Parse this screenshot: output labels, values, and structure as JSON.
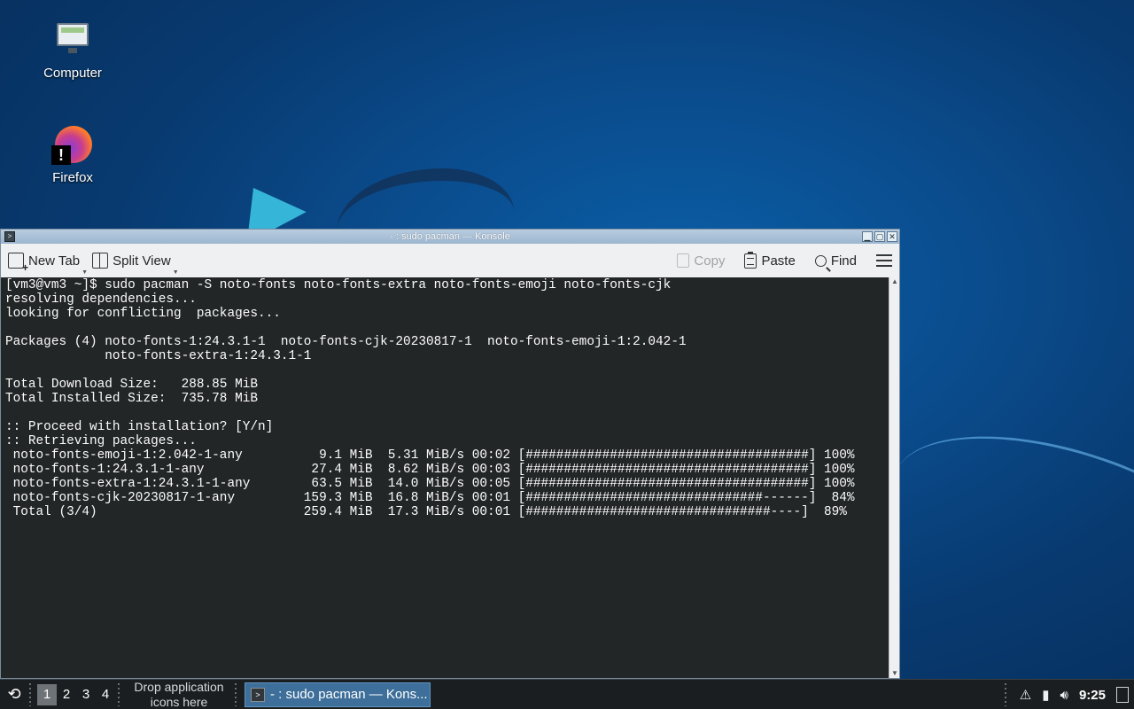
{
  "desktop": {
    "icons": [
      {
        "label": "Computer",
        "icon": "computer-icon"
      },
      {
        "label": "Firefox",
        "icon": "firefox-icon",
        "badge": "!"
      }
    ]
  },
  "window": {
    "title": "- : sudo pacman — Konsole",
    "app_icon": "terminal-icon",
    "controls": {
      "minimize": "▁",
      "maximize": "▢",
      "close": "✕"
    }
  },
  "toolbar": {
    "new_tab": "New Tab",
    "split_view": "Split View",
    "copy": "Copy",
    "paste": "Paste",
    "find": "Find",
    "menu_icon": "hamburger-menu-icon"
  },
  "terminal": {
    "lines": [
      "[vm3@vm3 ~]$ sudo pacman -S noto-fonts noto-fonts-extra noto-fonts-emoji noto-fonts-cjk",
      "resolving dependencies...",
      "looking for conflicting  packages...",
      "",
      "Packages (4) noto-fonts-1:24.3.1-1  noto-fonts-cjk-20230817-1  noto-fonts-emoji-1:2.042-1",
      "             noto-fonts-extra-1:24.3.1-1",
      "",
      "Total Download Size:   288.85 MiB",
      "Total Installed Size:  735.78 MiB",
      "",
      ":: Proceed with installation? [Y/n]",
      ":: Retrieving packages...",
      " noto-fonts-emoji-1:2.042-1-any          9.1 MiB  5.31 MiB/s 00:02 [#####################################] 100%",
      " noto-fonts-1:24.3.1-1-any              27.4 MiB  8.62 MiB/s 00:03 [#####################################] 100%",
      " noto-fonts-extra-1:24.3.1-1-any        63.5 MiB  14.0 MiB/s 00:05 [#####################################] 100%",
      " noto-fonts-cjk-20230817-1-any         159.3 MiB  16.8 MiB/s 00:01 [###############################------]  84%",
      " Total (3/4)                           259.4 MiB  17.3 MiB/s 00:01 [################################----]  89%"
    ]
  },
  "taskbar": {
    "menu_icon": "application-menu-icon",
    "desktops": [
      "1",
      "2",
      "3",
      "4"
    ],
    "active_desktop": "1",
    "launcher_hint": "Drop application icons here",
    "task_label": "- : sudo pacman — Kons...",
    "tray": {
      "warning_icon": "warning-icon",
      "usb_icon": "removable-device-icon",
      "volume_icon": "volume-icon",
      "clock": "9:25",
      "show_desktop_icon": "show-desktop-icon"
    }
  }
}
